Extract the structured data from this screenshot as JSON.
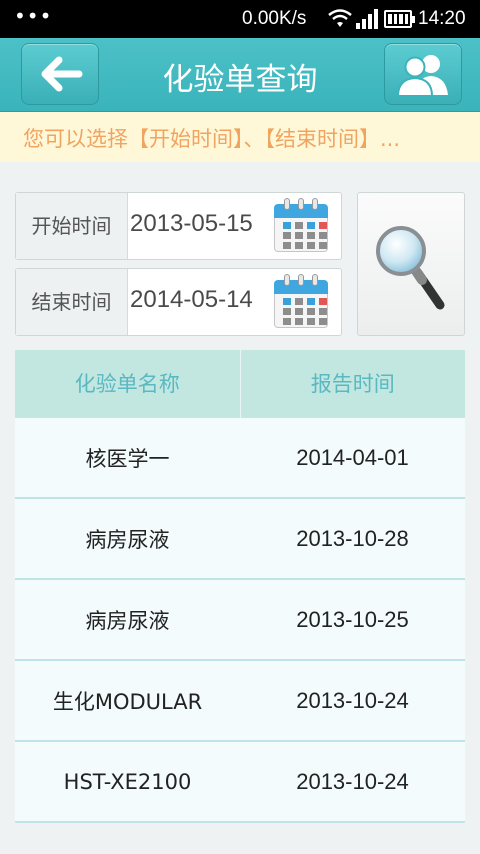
{
  "status_bar": {
    "network_speed": "0.00K/s",
    "time": "14:20",
    "icons": [
      "menu-dots-icon",
      "wifi-icon",
      "signal-icon",
      "battery-icon"
    ]
  },
  "header": {
    "title": "化验单查询",
    "back_icon": "back-arrow-icon",
    "user_icon": "users-icon"
  },
  "notice": {
    "text": "您可以选择【开始时间】、【结束时间】..."
  },
  "filters": {
    "start_label": "开始时间",
    "start_value": "2013-05-15",
    "end_label": "结束时间",
    "end_value": "2014-05-14",
    "search_icon": "magnifier-icon"
  },
  "table": {
    "columns": [
      "化验单名称",
      "报告时间"
    ],
    "rows": [
      {
        "name": "核医学一",
        "date": "2014-04-01"
      },
      {
        "name": "病房尿液",
        "date": "2013-10-28"
      },
      {
        "name": "病房尿液",
        "date": "2013-10-25"
      },
      {
        "name": "生化MODULAR",
        "date": "2013-10-24"
      },
      {
        "name": "HST-XE2100",
        "date": "2013-10-24"
      }
    ]
  },
  "colors": {
    "header": "#3fb8bf",
    "notice_bg": "#fff8d8",
    "notice_text": "#f1a45f",
    "table_header_bg": "#c2e7e1",
    "table_header_text": "#5bb8c1"
  }
}
